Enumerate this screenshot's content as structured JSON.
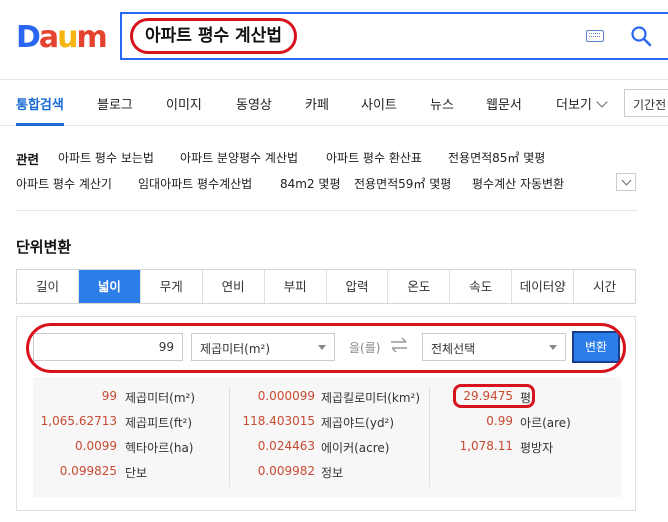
{
  "search": {
    "query": "아파트 평수 계산법",
    "logo_letters": [
      {
        "ch": "D",
        "color": "#2a66f2"
      },
      {
        "ch": "a",
        "color": "#e4432f"
      },
      {
        "ch": "u",
        "color": "#f5b40e"
      },
      {
        "ch": "m",
        "color": "#e4432f"
      }
    ]
  },
  "nav": {
    "tabs": [
      "통합검색",
      "블로그",
      "이미지",
      "동영상",
      "카페",
      "사이트",
      "뉴스",
      "웹문서",
      "더보기"
    ],
    "period": "기간전"
  },
  "related": {
    "label": "관련",
    "links": [
      "아파트 평수 보는법",
      "아파트 분양평수 계산법",
      "아파트 평수 환산표",
      "전용면적85㎡ 몇평",
      "아파트 평수 계산기",
      "임대아파트 평수계산법",
      "84m2 몇평",
      "전용면적59㎡ 몇평",
      "평수계산 자동변환"
    ]
  },
  "converter": {
    "title": "단위변환",
    "tabs": [
      "길이",
      "넓이",
      "무게",
      "연비",
      "부피",
      "압력",
      "온도",
      "속도",
      "데이터양",
      "시간"
    ],
    "active_tab": "넓이",
    "input_value": "99",
    "from_unit": "제곱미터(m²)",
    "eul_label": "을(를)",
    "to_unit": "전체선택",
    "convert_label": "변환",
    "results": [
      [
        {
          "value": "99",
          "unit": "제곱미터(m²)"
        },
        {
          "value": "1,065.62713",
          "unit": "제곱피트(ft²)"
        },
        {
          "value": "0.0099",
          "unit": "헥타아르(ha)"
        },
        {
          "value": "0.099825",
          "unit": "단보"
        }
      ],
      [
        {
          "value": "0.000099",
          "unit": "제곱킬로미터(km²)"
        },
        {
          "value": "118.403015",
          "unit": "제곱야드(yd²)"
        },
        {
          "value": "0.024463",
          "unit": "에이커(acre)"
        },
        {
          "value": "0.009982",
          "unit": "정보"
        }
      ],
      [
        {
          "value": "29.9475",
          "unit": "평"
        },
        {
          "value": "0.99",
          "unit": "아르(are)"
        },
        {
          "value": "1,078.11",
          "unit": "평방자"
        }
      ]
    ]
  }
}
